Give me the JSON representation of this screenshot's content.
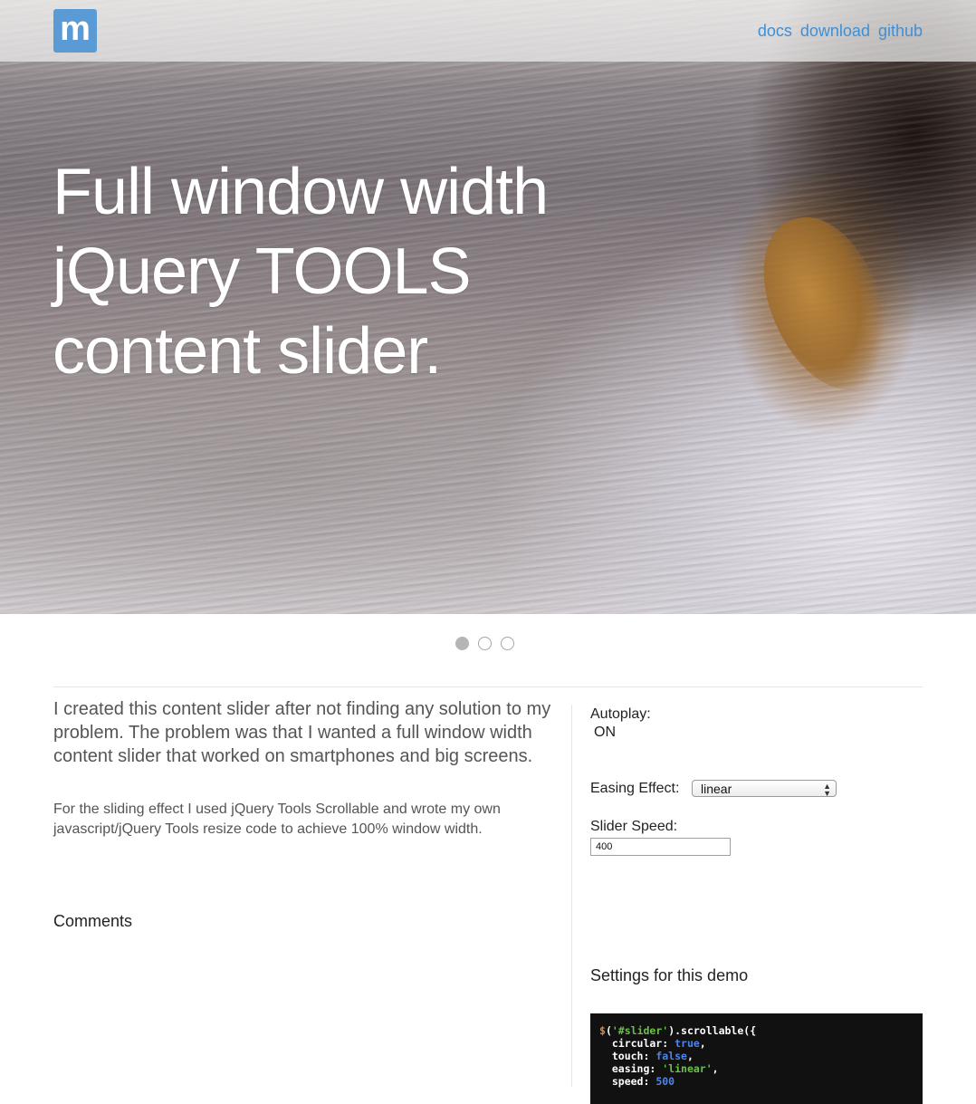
{
  "nav": {
    "logo_letter": "m",
    "links": [
      "docs",
      "download",
      "github"
    ]
  },
  "hero": {
    "title_lines": [
      "Full window width",
      "jQuery TOOLS",
      "content slider."
    ]
  },
  "slider": {
    "dot_count": 3,
    "active_index": 0
  },
  "content": {
    "lead": "I created this content slider after not finding any solution to my problem. The problem was that I wanted a full window width content slider that worked on smartphones and big screens.",
    "sub": "For the sliding effect I used jQuery Tools Scrollable and wrote my own javascript/jQuery Tools resize code to achieve 100% window width.",
    "comments_heading": "Comments"
  },
  "settings": {
    "autoplay_label": "Autoplay:",
    "autoplay_value": "ON",
    "easing_label": "Easing Effect:",
    "easing_value": "linear",
    "speed_label": "Slider Speed:",
    "speed_value": "400",
    "demo_heading": "Settings for this demo"
  },
  "code": {
    "dollar": "$",
    "selector_open": "(",
    "selector": "'#slider'",
    "call": ").scrollable({",
    "lines": [
      {
        "key": "  circular: ",
        "value": "true",
        "kind": "bool",
        "end": ","
      },
      {
        "key": "  touch: ",
        "value": "false",
        "kind": "bool",
        "end": ","
      },
      {
        "key": "  easing: ",
        "value": "'linear'",
        "kind": "str",
        "end": ","
      },
      {
        "key": "  speed: ",
        "value": "500",
        "kind": "num",
        "end": ""
      }
    ]
  },
  "colors": {
    "link": "#3f8fd6",
    "logo_bg": "#5b9bd5",
    "code_bg": "#111111"
  }
}
